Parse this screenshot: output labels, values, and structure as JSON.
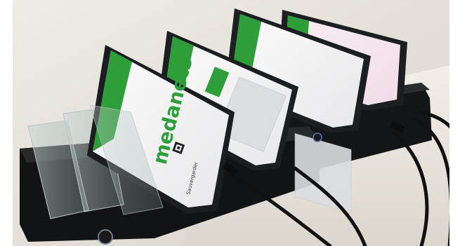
{
  "scene": {
    "description_visible_text": {
      "front_phone_brand": "medanets",
      "front_phone_caption": "Sauvergarder"
    },
    "colors": {
      "app_green": "#2e9e3a",
      "phone_body": "#1c1f22",
      "dock_black": "#151617",
      "wall": "#e8e4dc",
      "table": "#ece7df",
      "stand_acrylic": "#9fb3b0"
    },
    "objects": [
      {
        "name": "charging-dock",
        "count": 2
      },
      {
        "name": "smartphone",
        "count": 4
      },
      {
        "name": "acrylic-stand",
        "count": 3
      },
      {
        "name": "usb-cable",
        "count": 5
      }
    ]
  }
}
